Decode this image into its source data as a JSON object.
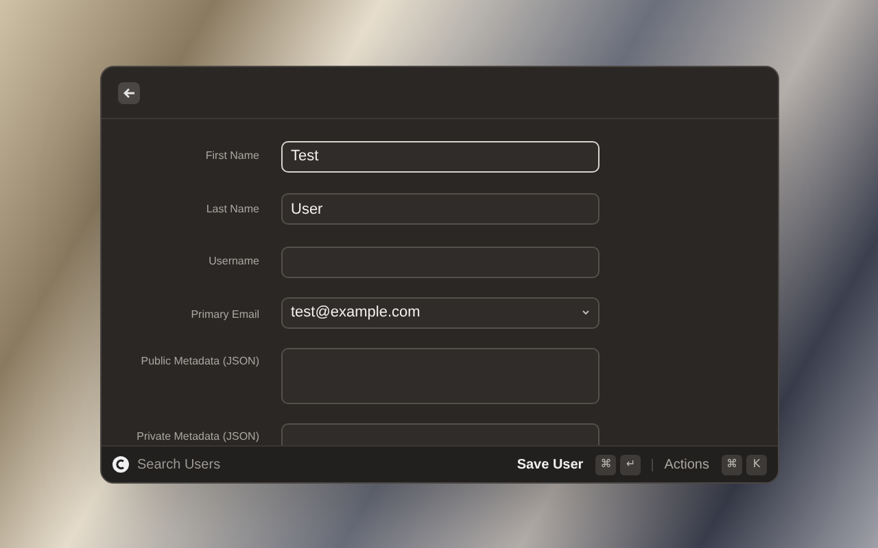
{
  "header": {
    "back_button": true
  },
  "form": {
    "fields": [
      {
        "label": "First Name",
        "kind": "text",
        "value": "Test",
        "focused": true
      },
      {
        "label": "Last Name",
        "kind": "text",
        "value": "User",
        "focused": false
      },
      {
        "label": "Username",
        "kind": "text",
        "focused": false
      },
      {
        "label": "Primary Email",
        "kind": "select",
        "value": "test@example.com",
        "focused": false
      },
      {
        "label": "Public Metadata (JSON)",
        "kind": "textarea",
        "focused": false
      },
      {
        "label": "Private Metadata (JSON)",
        "kind": "textarea",
        "focused": false
      }
    ]
  },
  "footer": {
    "search_placeholder": "Search Users",
    "primary_action": {
      "label": "Save User",
      "keys": [
        "⌘",
        "↵"
      ]
    },
    "actions": {
      "label": "Actions",
      "keys": [
        "⌘",
        "K"
      ]
    }
  }
}
